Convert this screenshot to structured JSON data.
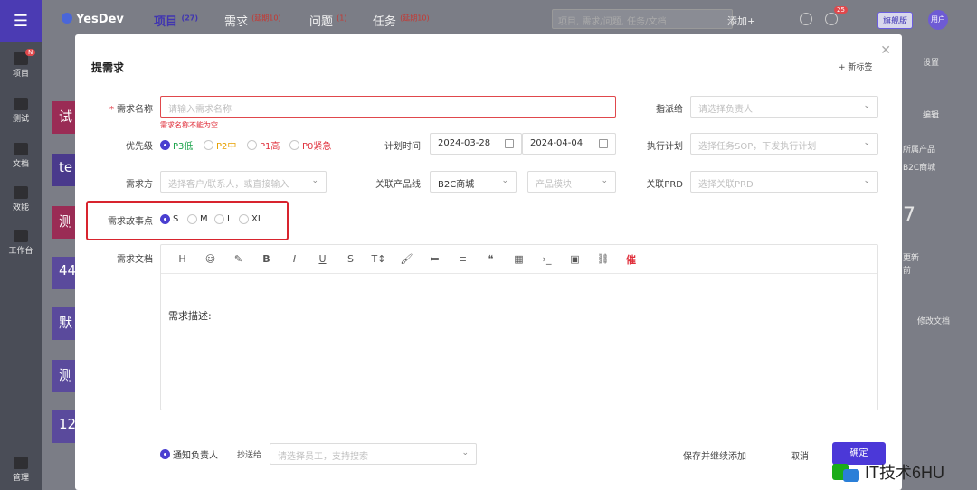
{
  "app": {
    "logo": "YesDev",
    "nav": [
      {
        "label": "项目",
        "badge": "(27)"
      },
      {
        "label": "需求",
        "badge": "(延期10)"
      },
      {
        "label": "问题",
        "badge": "(1)"
      },
      {
        "label": "任务",
        "badge": "(延期10)"
      }
    ],
    "search_placeholder": "项目, 需求/问题, 任务/文档",
    "add_label": "添加+",
    "notif_badge": "25",
    "upgrade_label": "旗舰版",
    "avatar_text": "用户",
    "sidebar": [
      {
        "label": "项目",
        "badge": "N"
      },
      {
        "label": "测试"
      },
      {
        "label": "文档"
      },
      {
        "label": "效能"
      },
      {
        "label": "工作台"
      },
      {
        "label": "管理"
      }
    ],
    "bg_cards": [
      "试",
      "te",
      "测",
      "44",
      "默",
      "测",
      "12"
    ],
    "bg_right": [
      "设置",
      "编辑",
      "所属产品",
      "B2C商城",
      "7",
      "更新",
      "前",
      "修改文档"
    ]
  },
  "modal": {
    "title": "提需求",
    "new_tag": "+ 新标签",
    "name": {
      "label": "需求名称",
      "placeholder": "请输入需求名称",
      "error": "需求名称不能为空"
    },
    "assignee": {
      "label": "指派给",
      "placeholder": "请选择负责人"
    },
    "priority": {
      "label": "优先级",
      "options": [
        "P3低",
        "P2中",
        "P1高",
        "P0紧急"
      ],
      "colors": [
        "#1aa34a",
        "#e6a000",
        "#e0303c",
        "#e0303c"
      ]
    },
    "plan_time": {
      "label": "计划时间",
      "start": "2024-03-28",
      "end": "2024-04-04"
    },
    "exec_plan": {
      "label": "执行计划",
      "placeholder": "选择任务SOP，下发执行计划"
    },
    "requester": {
      "label": "需求方",
      "placeholder": "选择客户/联系人，或直接输入"
    },
    "product_line": {
      "label": "关联产品线",
      "value": "B2C商城",
      "module_placeholder": "产品模块"
    },
    "prd": {
      "label": "关联PRD",
      "placeholder": "选择关联PRD"
    },
    "story_points": {
      "label": "需求故事点",
      "options": [
        "S",
        "M",
        "L",
        "XL"
      ]
    },
    "doc": {
      "label": "需求文档",
      "toolbar": [
        "H",
        "☺",
        "✎",
        "B",
        "I",
        "U",
        "S",
        "T↕",
        "🖌",
        "≔",
        "≡",
        "❝",
        "▦",
        "›_",
        "▣",
        "⛓",
        "催"
      ],
      "body": "需求描述:"
    },
    "footer": {
      "notify": "通知负责人",
      "cc_label": "抄送给",
      "cc_placeholder": "请选择员工，支持搜索",
      "save_continue": "保存并继续添加",
      "cancel": "取消",
      "confirm": "确定"
    }
  },
  "watermark": "IT技术6HU"
}
